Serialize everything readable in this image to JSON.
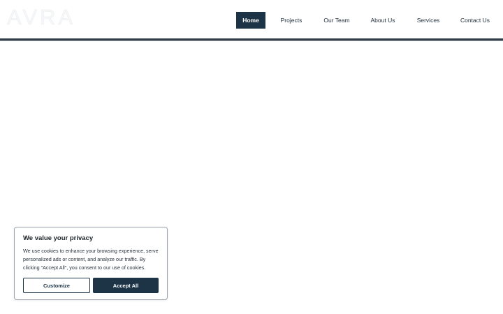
{
  "header": {
    "logo_text": "AVRA",
    "nav": [
      {
        "label": "Home",
        "active": true
      },
      {
        "label": "Projects",
        "active": false
      },
      {
        "label": "Our Team",
        "active": false
      },
      {
        "label": "About Us",
        "active": false
      },
      {
        "label": "Services",
        "active": false
      },
      {
        "label": "Contact Us",
        "active": false
      }
    ]
  },
  "cookie_banner": {
    "title": "We value your privacy",
    "body": "We use cookies to enhance your browsing experience, serve personalized ads or content, and analyze our traffic. By clicking \"Accept All\", you consent to our use of cookies.",
    "customize_label": "Customize",
    "accept_label": "Accept All"
  },
  "colors": {
    "brand_navy": "#1d3446",
    "text": "#1f2d3a"
  }
}
